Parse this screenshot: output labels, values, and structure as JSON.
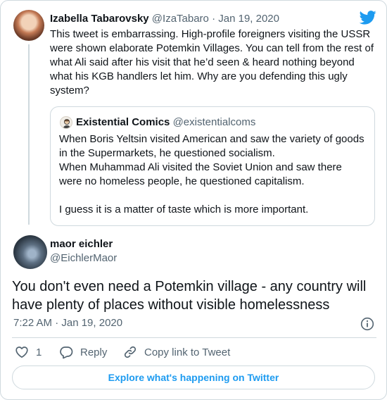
{
  "parent_tweet": {
    "author_name": "Izabella Tabarovsky",
    "author_handle": "@IzaTabaro",
    "separator": "·",
    "date": "Jan 19, 2020",
    "text": "This tweet is embarrassing. High-profile foreigners visiting the USSR\nwere shown elaborate Potemkin Villages. You can tell from the rest of\nwhat Ali said after his visit that he’d seen & heard nothing beyond\nwhat his KGB handlers let him. Why are you defending this ugly\nsystem?"
  },
  "quoted_tweet": {
    "author_name": "Existential Comics",
    "author_handle": "@existentialcoms",
    "text": "When Boris Yeltsin visited American and saw the variety of goods\nin the Supermarkets, he questioned socialism.\nWhen Muhammad Ali visited the Soviet Union and saw there\nwere no homeless people, he questioned capitalism.\n\nI guess it is a matter of taste which is more important."
  },
  "reply_tweet": {
    "author_name": "maor eichler",
    "author_handle": "@EichlerMaor",
    "text": "You don't even need a Potemkin village - any country will have plenty of places without visible homelessness",
    "timestamp": "7:22 AM · Jan 19, 2020"
  },
  "actions": {
    "like_count": "1",
    "reply_label": "Reply",
    "copy_link_label": "Copy link to Tweet"
  },
  "explore_label": "Explore what's happening on Twitter",
  "colors": {
    "accent": "#1d9bf0",
    "muted_text": "#536471",
    "border": "#cfd9de"
  }
}
